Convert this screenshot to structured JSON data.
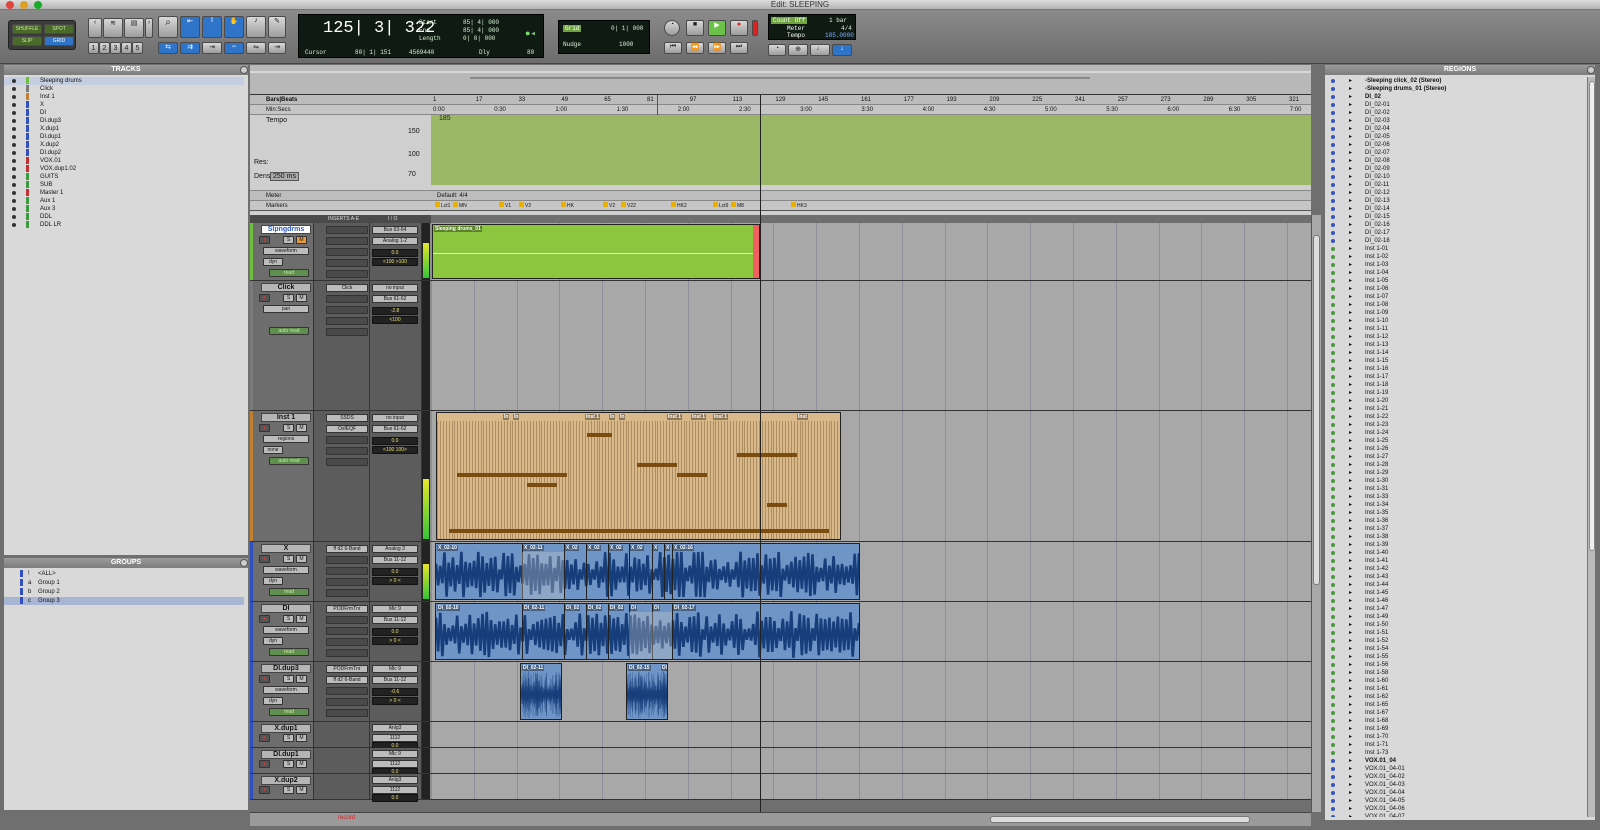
{
  "window": {
    "title": "Edit: SLEEPING"
  },
  "toolbar": {
    "modes": [
      "SHUFFLE",
      "SPOT",
      "SLIP",
      "GRID"
    ],
    "zoom_presets": [
      "1",
      "2",
      "3",
      "4",
      "5"
    ],
    "main_counter": "125| 3| 322",
    "start_label": "Start",
    "start_value": "85| 4| 000",
    "end_label": "End",
    "end_value": "85| 4| 000",
    "length_label": "Length",
    "length_value": "0| 0| 000",
    "cursor_label": "Cursor",
    "cursor_value": "80| 1| 151",
    "sample_value": "4569440",
    "dly_label": "Dly",
    "nudge_small": "80",
    "grid_label": "Grid",
    "grid_value": "0| 1| 000",
    "nudge_label": "Nudge",
    "nudge_value": "1000",
    "count_off": "Count Off",
    "count_off_value": "1 bar",
    "meter_label": "Meter",
    "meter_value": "4/4",
    "tempo_label": "Tempo",
    "tempo_value": "185.0000"
  },
  "tracks_panel": {
    "title": "TRACKS",
    "items": [
      {
        "name": "Sleeping drums",
        "color": "#6fbf3f"
      },
      {
        "name": "Click",
        "color": "#7a7a7a"
      },
      {
        "name": "Inst 1",
        "color": "#c08030"
      },
      {
        "name": "X",
        "color": "#3050c0"
      },
      {
        "name": "DI",
        "color": "#3050c0"
      },
      {
        "name": "DI.dup3",
        "color": "#3050c0"
      },
      {
        "name": "X.dup1",
        "color": "#3050c0"
      },
      {
        "name": "DI.dup1",
        "color": "#3050c0"
      },
      {
        "name": "X.dup2",
        "color": "#3050c0"
      },
      {
        "name": "DI.dup2",
        "color": "#3050c0"
      },
      {
        "name": "VOX.01",
        "color": "#c03030"
      },
      {
        "name": "VOX.dup1.02",
        "color": "#c03030"
      },
      {
        "name": "GUITS",
        "color": "#3c9a3c"
      },
      {
        "name": "SUB",
        "color": "#3c9a3c"
      },
      {
        "name": "Master 1",
        "color": "#c03030"
      },
      {
        "name": "Aux 1",
        "color": "#3c9a3c"
      },
      {
        "name": "Aux 3",
        "color": "#3c9a3c"
      },
      {
        "name": "DDL",
        "color": "#3c9a3c"
      },
      {
        "name": "DDL LR",
        "color": "#3c9a3c"
      }
    ]
  },
  "groups_panel": {
    "title": "GROUPS",
    "items": [
      {
        "key": "!",
        "name": "<ALL>"
      },
      {
        "key": "a",
        "name": "Group 1"
      },
      {
        "key": "b",
        "name": "Group 2"
      },
      {
        "key": "c",
        "name": "Group 3"
      }
    ]
  },
  "rulers": {
    "bars_label": "Bars|Beats",
    "bars_ticks": [
      "1",
      "17",
      "33",
      "49",
      "65",
      "81",
      "97",
      "113",
      "129",
      "145",
      "161",
      "177",
      "193",
      "209",
      "225",
      "241",
      "257",
      "273",
      "289",
      "305",
      "321"
    ],
    "minsecs_label": "Min:Secs",
    "minsecs_ticks": [
      "0:00",
      "0:30",
      "1:00",
      "1:30",
      "2:00",
      "2:30",
      "3:00",
      "3:30",
      "4:00",
      "4:30",
      "5:00",
      "5:30",
      "6:00",
      "6:30",
      "7:00"
    ],
    "tempo_label": "Tempo",
    "tempo_value": "185",
    "tempo_scale": [
      "150",
      "100",
      "70"
    ],
    "res_label": "Res:",
    "dens_label": "Dens:",
    "dens_value": "250 ms",
    "meter_label": "Meter",
    "meter_value": "Default: 4/4",
    "markers_label": "Markers",
    "markers": [
      "Lct1",
      "MN",
      "V1",
      "V2",
      "HK",
      "V2",
      "V22",
      "HK2",
      "Lct9",
      "M8",
      "HK3"
    ]
  },
  "edit_header": {
    "inserts": "INSERTS A-E",
    "io": "I / O"
  },
  "tracks": [
    {
      "name": "Slpngdrms",
      "view": "waveform",
      "mode": "dyn",
      "auto": "read",
      "inserts": [],
      "io_in": "Bus 63-64",
      "io_out": "Analog 1-2",
      "vol": "0.0",
      "pan": "<100 >100"
    },
    {
      "name": "Click",
      "view": "pan",
      "mode": "",
      "auto": "auto read",
      "inserts": [
        "Click"
      ],
      "io_in": "no input",
      "io_out": "Bus 61-62",
      "vol": "-2.8",
      "pan": "<100"
    },
    {
      "name": "Inst 1",
      "view": "regions",
      "mode": "none",
      "auto": "auto read",
      "inserts": [
        "SSDS",
        "OxfEQF"
      ],
      "io_in": "no input",
      "io_out": "Bus 61-62",
      "vol": "0.0",
      "pan": "<100 100>"
    },
    {
      "name": "X",
      "view": "waveform",
      "mode": "dyn",
      "auto": "read",
      "inserts": [
        "ff d2 6-Band"
      ],
      "io_in": "Analog 3",
      "io_out": "Bus 11-12",
      "vol": "0.0",
      "pan": "> 0 <"
    },
    {
      "name": "DI",
      "view": "waveform",
      "mode": "dyn",
      "auto": "read",
      "inserts": [
        "PODFrmTnr"
      ],
      "io_in": "Mic 9",
      "io_out": "Bus 11-12",
      "vol": "0.0",
      "pan": "> 0 <"
    },
    {
      "name": "DI.dup3",
      "view": "waveform",
      "mode": "dyn",
      "auto": "read",
      "inserts": [
        "PODFrmTnr",
        "ff d2 6-Band"
      ],
      "io_in": "Mic 9",
      "io_out": "Bus 11-12",
      "vol": "-0.6",
      "pan": "> 0 <"
    },
    {
      "name": "X.dup1",
      "io_in": "Anlg3",
      "io_out": "1112",
      "vol": "0.0",
      "pan": "<100"
    },
    {
      "name": "DI.dup1",
      "io_in": "Mic 9",
      "io_out": "1112",
      "vol": "0.0",
      "pan": "> 0 <"
    },
    {
      "name": "X.dup2",
      "io_in": "Anlg3",
      "io_out": "1112",
      "vol": "0.0",
      "pan": "100>"
    }
  ],
  "regions": {
    "drums": "Sleeping drums_01",
    "inst": [
      "In",
      "In",
      "Inst 1",
      "In",
      "In",
      "Inst 1",
      "Inst 1",
      "Inst 1",
      "Inst"
    ],
    "x": [
      "X_02-10",
      "X_02-11",
      "X_02",
      "X_02",
      "X_02",
      "X_02",
      "X",
      "X",
      "X_02-16"
    ],
    "di": [
      "DI_02-10",
      "DI_02-11",
      "DI_02",
      "DI_02",
      "DI_02",
      "DI",
      "DI",
      "DI_02-17"
    ],
    "dup3": [
      "DI_02-11",
      "DI_02-15",
      "DI"
    ]
  },
  "bottom": {
    "record": "record"
  },
  "regions_panel": {
    "title": "REGIONS",
    "items": [
      "-Sleeping click_02 (Stereo)",
      "-Sleeping drums_01 (Stereo)",
      "DI_02",
      "DI_02-01",
      "DI_02-02",
      "DI_02-03",
      "DI_02-04",
      "DI_02-05",
      "DI_02-06",
      "DI_02-07",
      "DI_02-08",
      "DI_02-09",
      "DI_02-10",
      "DI_02-11",
      "DI_02-12",
      "DI_02-13",
      "DI_02-14",
      "DI_02-15",
      "DI_02-16",
      "DI_02-17",
      "DI_02-18",
      "Inst 1-01",
      "Inst 1-02",
      "Inst 1-03",
      "Inst 1-04",
      "Inst 1-05",
      "Inst 1-06",
      "Inst 1-07",
      "Inst 1-08",
      "Inst 1-09",
      "Inst 1-10",
      "Inst 1-11",
      "Inst 1-12",
      "Inst 1-13",
      "Inst 1-14",
      "Inst 1-15",
      "Inst 1-16",
      "Inst 1-17",
      "Inst 1-18",
      "Inst 1-19",
      "Inst 1-20",
      "Inst 1-21",
      "Inst 1-22",
      "Inst 1-23",
      "Inst 1-24",
      "Inst 1-25",
      "Inst 1-26",
      "Inst 1-27",
      "Inst 1-28",
      "Inst 1-29",
      "Inst 1-30",
      "Inst 1-31",
      "Inst 1-33",
      "Inst 1-34",
      "Inst 1-35",
      "Inst 1-36",
      "Inst 1-37",
      "Inst 1-38",
      "Inst 1-39",
      "Inst 1-40",
      "Inst 1-41",
      "Inst 1-42",
      "Inst 1-43",
      "Inst 1-44",
      "Inst 1-45",
      "Inst 1-46",
      "Inst 1-47",
      "Inst 1-49",
      "Inst 1-50",
      "Inst 1-51",
      "Inst 1-52",
      "Inst 1-54",
      "Inst 1-55",
      "Inst 1-56",
      "Inst 1-58",
      "Inst 1-60",
      "Inst 1-61",
      "Inst 1-62",
      "Inst 1-65",
      "Inst 1-67",
      "Inst 1-68",
      "Inst 1-69",
      "Inst 1-70",
      "Inst 1-71",
      "Inst 1-73",
      "VOX.01_04",
      "VOX.01_04-01",
      "VOX.01_04-02",
      "VOX.01_04-03",
      "VOX.01_04-04",
      "VOX.01_04-05",
      "VOX.01_04-06",
      "VOX.01_04-07"
    ]
  },
  "colors": {
    "drums": "#8cc63f",
    "inst": "#d9b98a",
    "audio": "#6f95c7",
    "tempo": "#9ab865",
    "selection": "#9aa9c6"
  }
}
